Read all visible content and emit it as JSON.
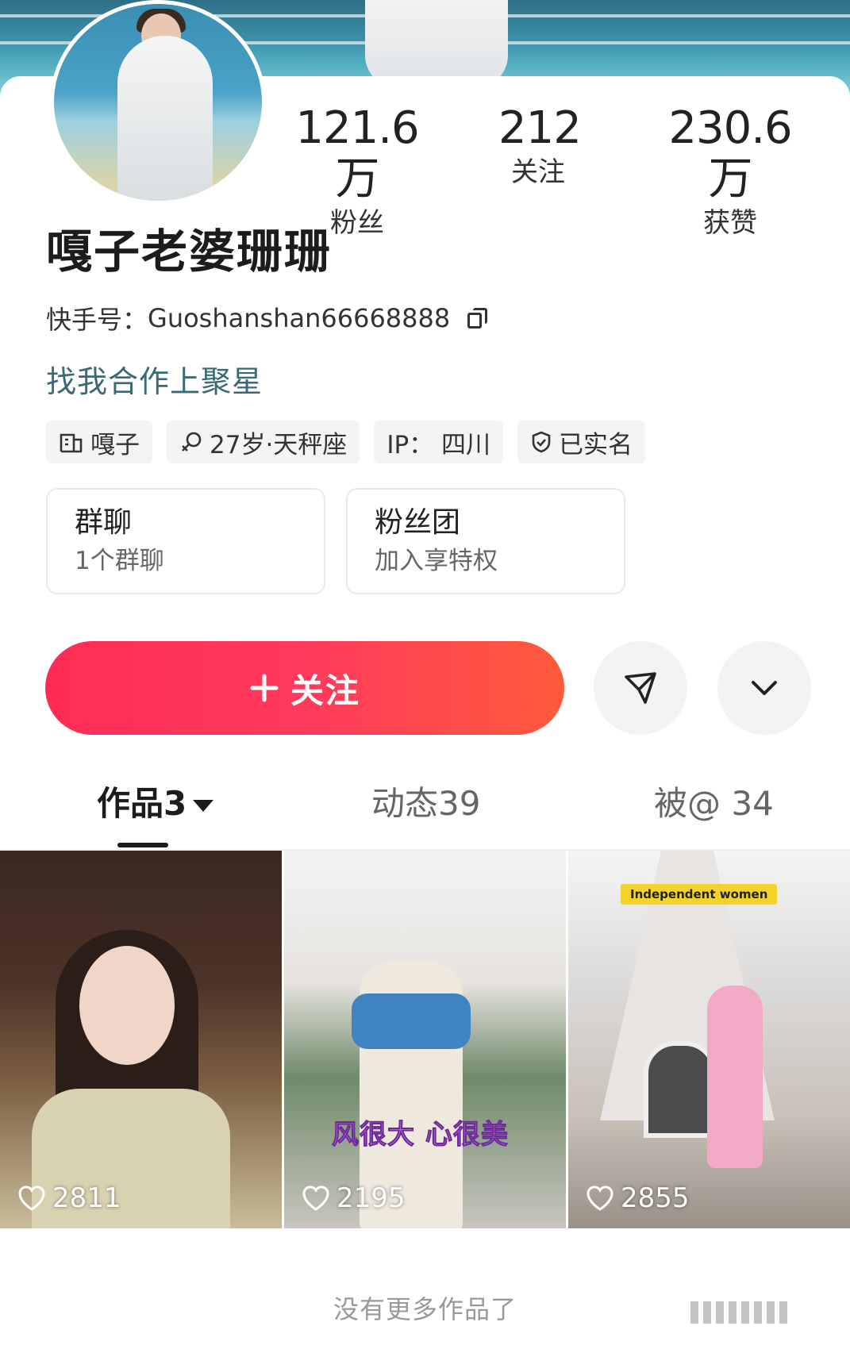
{
  "stats": [
    {
      "value": "121.6万",
      "label": "粉丝"
    },
    {
      "value": "212",
      "label": "关注"
    },
    {
      "value": "230.6万",
      "label": "获赞"
    }
  ],
  "profile": {
    "name": "嘎子老婆珊珊",
    "id_label": "快手号：",
    "id_value": "Guoshanshan66668888",
    "bio": "找我合作上聚星"
  },
  "tags": [
    {
      "icon": "building-icon",
      "text": "嘎子"
    },
    {
      "icon": "female-icon",
      "text": "27岁·天秤座"
    },
    {
      "icon": "",
      "text": "IP：  四川"
    },
    {
      "icon": "verified-shield-icon",
      "text": "已实名"
    }
  ],
  "cards": [
    {
      "title": "群聊",
      "subtitle": "1个群聊"
    },
    {
      "title": "粉丝团",
      "subtitle": "加入享特权"
    }
  ],
  "actions": {
    "follow_label": "关注",
    "follow_icon": "plus-icon"
  },
  "tabs": [
    {
      "label": "作品3",
      "active": true
    },
    {
      "label": "动态39",
      "active": false
    },
    {
      "label": "被@ 34",
      "active": false
    }
  ],
  "videos": [
    {
      "likes": "2811",
      "caption": "",
      "badge": ""
    },
    {
      "likes": "2195",
      "caption": "风很大 心很美",
      "badge": ""
    },
    {
      "likes": "2855",
      "caption": "",
      "badge": "Independent women"
    }
  ],
  "footer": {
    "no_more": "没有更多作品了"
  },
  "colors": {
    "follow_button_start": "#fe2c55",
    "follow_button_end": "#ff5a3c",
    "bio_color": "#3a6a73"
  }
}
